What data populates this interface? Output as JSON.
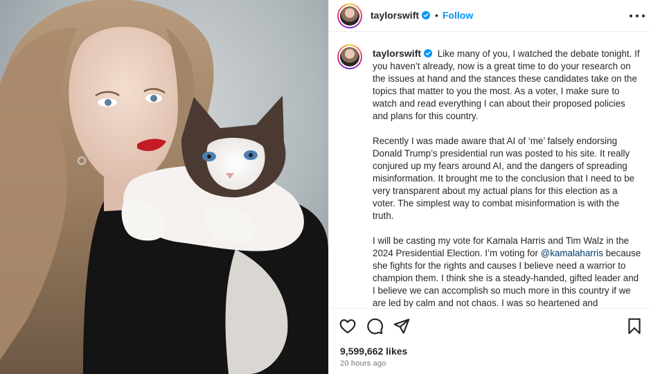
{
  "post": {
    "author": "taylorswift",
    "follow_label": "Follow",
    "separator": "•",
    "caption_paragraphs": [
      "Like many of you, I watched the debate tonight. If you haven’t already, now is a great time to do your research on the issues at hand and the stances these candidates take on the topics that matter to you the most. As a voter, I make sure to watch and read everything I can about their proposed policies and plans for this country.",
      "Recently I was made aware that AI of ‘me’ falsely endorsing Donald Trump’s presidential run was posted to his site. It really conjured up my fears around AI, and the dangers of spreading misinformation. It brought me to the conclusion that I need to be very transparent about my actual plans for this election as a voter. The simplest way to combat misinformation is with the truth."
    ],
    "caption_p3_before": "I will be casting my vote for Kamala Harris and Tim Walz in the 2024 Presidential Election. I’m voting for ",
    "caption_p3_mention": "@kamalaharris",
    "caption_p3_after": " because she fights for the rights and causes I believe need a warrior to champion them. I think she is a steady-handed, gifted leader and I believe we can accomplish so much more in this country if we are led by calm and not chaos. I was so heartened and impressed by her selection of running mate",
    "likes": "9,599,662 likes",
    "time_ago": "20 hours ago"
  },
  "icons": {
    "like": "heart-icon",
    "comment": "comment-icon",
    "share": "paper-plane-icon",
    "save": "bookmark-icon",
    "more": "more-dots-icon",
    "verified": "verified-badge-icon"
  },
  "colors": {
    "follow": "#0095f6",
    "verified": "#0095f6",
    "mention": "#00376b",
    "muted": "#737373"
  }
}
